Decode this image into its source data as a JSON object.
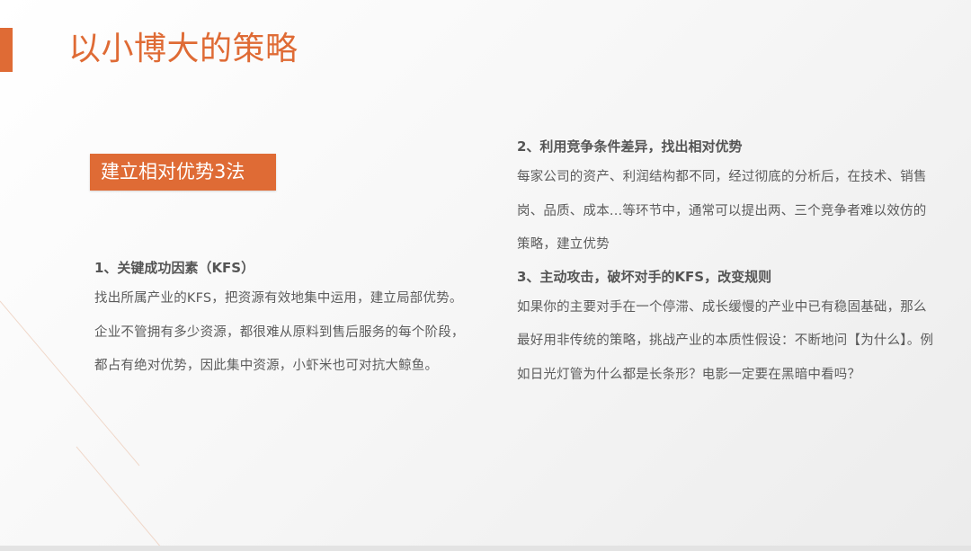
{
  "colors": {
    "accent": "#df6b35",
    "text": "#5c5c5c",
    "heading": "#555555"
  },
  "slide": {
    "title": "以小博大的策略",
    "badge": "建立相对优势3法",
    "section1": {
      "heading": "1、关键成功因素（KFS）",
      "body": "找出所属产业的KFS，把资源有效地集中运用，建立局部优势。企业不管拥有多少资源，都很难从原料到售后服务的每个阶段，都占有绝对优势，因此集中资源，小虾米也可对抗大鲸鱼。"
    },
    "section2": {
      "heading": "2、利用竞争条件差异，找出相对优势",
      "body": "每家公司的资产、利润结构都不同，经过彻底的分析后，在技术、销售岗、品质、成本...等环节中，通常可以提出两、三个竞争者难以效仿的策略，建立优势"
    },
    "section3": {
      "heading": "3、主动攻击，破坏对手的KFS，改变规则",
      "body": "如果你的主要对手在一个停滞、成长缓慢的产业中已有稳固基础，那么最好用非传统的策略，挑战产业的本质性假设：不断地问【为什么】。例如日光灯管为什么都是长条形？电影一定要在黑暗中看吗？"
    }
  }
}
